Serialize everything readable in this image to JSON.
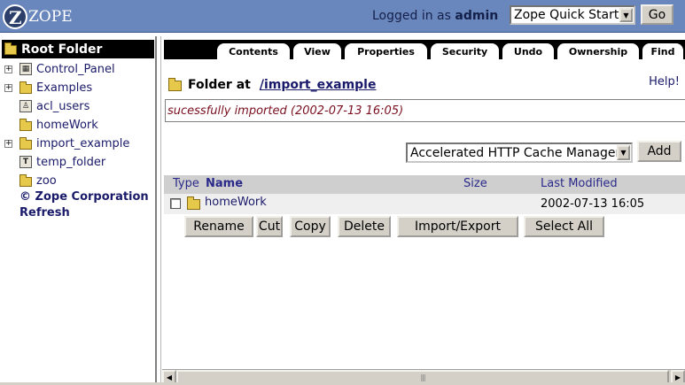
{
  "header": {
    "logo_text": "ZOPE",
    "logged_in_prefix": "Logged in as",
    "username": "admin",
    "quick_start_value": "Zope Quick Start",
    "go_label": "Go"
  },
  "tree": {
    "root_label": "Root Folder",
    "items": [
      {
        "label": "Control_Panel",
        "expandable": true,
        "icon": "control-panel-icon"
      },
      {
        "label": "Examples",
        "expandable": true,
        "icon": "folder-icon"
      },
      {
        "label": "acl_users",
        "expandable": false,
        "icon": "user-folder-icon"
      },
      {
        "label": "homeWork",
        "expandable": false,
        "icon": "folder-icon"
      },
      {
        "label": "import_example",
        "expandable": true,
        "icon": "folder-icon"
      },
      {
        "label": "temp_folder",
        "expandable": true,
        "icon": "temp-folder-icon"
      },
      {
        "label": "zoo",
        "expandable": false,
        "icon": "folder-icon"
      }
    ],
    "copyright": "© Zope Corporation",
    "refresh_label": "Refresh"
  },
  "tabs": [
    {
      "label": "Contents"
    },
    {
      "label": "View"
    },
    {
      "label": "Properties"
    },
    {
      "label": "Security"
    },
    {
      "label": "Undo"
    },
    {
      "label": "Ownership"
    },
    {
      "label": "Find"
    }
  ],
  "content": {
    "folder_at_label": "Folder at",
    "folder_path": "/import_example",
    "help_label": "Help!",
    "message": "sucessfully imported (2002-07-13 16:05)",
    "add_type_value": "Accelerated HTTP Cache Manager",
    "add_label": "Add",
    "columns": {
      "type": "Type",
      "name": "Name",
      "size": "Size",
      "modified": "Last Modified"
    },
    "rows": [
      {
        "name": "homeWork",
        "size": "",
        "modified": "2002-07-13 16:05"
      }
    ],
    "actions": {
      "rename": "Rename",
      "cut": "Cut",
      "copy": "Copy",
      "delete": "Delete",
      "import_export": "Import/Export",
      "select_all": "Select All"
    }
  },
  "colors": {
    "header_bg": "#6a87bd",
    "link": "#1a1a6a",
    "message_text": "#7a1020"
  }
}
